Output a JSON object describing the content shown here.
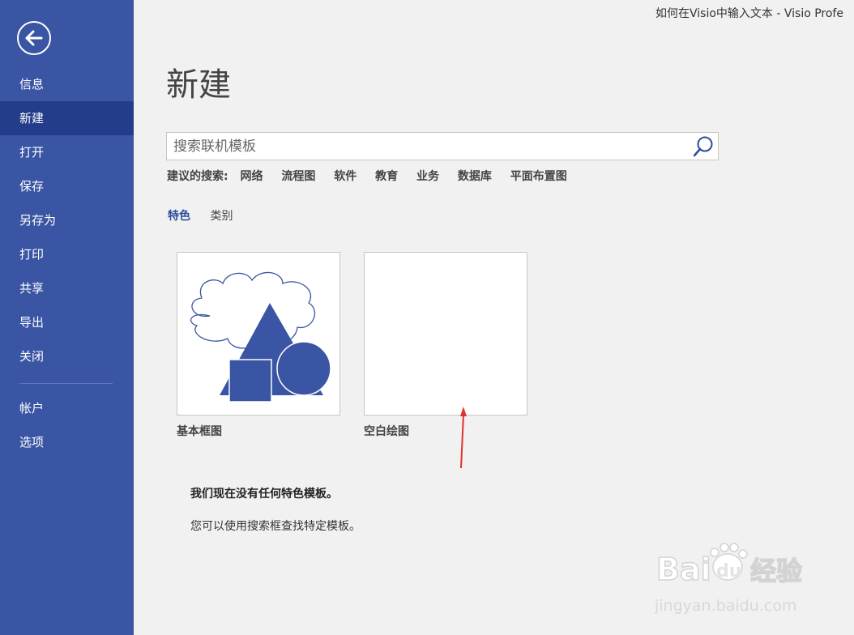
{
  "window": {
    "title": "如何在Visio中输入文本 - Visio Profe"
  },
  "sidebar": {
    "items": [
      {
        "label": "信息",
        "active": false
      },
      {
        "label": "新建",
        "active": true
      },
      {
        "label": "打开",
        "active": false
      },
      {
        "label": "保存",
        "active": false
      },
      {
        "label": "另存为",
        "active": false
      },
      {
        "label": "打印",
        "active": false
      },
      {
        "label": "共享",
        "active": false
      },
      {
        "label": "导出",
        "active": false
      },
      {
        "label": "关闭",
        "active": false
      }
    ],
    "bottom_items": [
      {
        "label": "帐户"
      },
      {
        "label": "选项"
      }
    ]
  },
  "main": {
    "title": "新建",
    "search": {
      "placeholder": "搜索联机模板",
      "value": ""
    },
    "suggested": {
      "label": "建议的搜索:",
      "links": [
        "网络",
        "流程图",
        "软件",
        "教育",
        "业务",
        "数据库",
        "平面布置图"
      ]
    },
    "tabs": [
      {
        "label": "特色",
        "active": true
      },
      {
        "label": "类别",
        "active": false
      }
    ],
    "templates": [
      {
        "label": "基本框图"
      },
      {
        "label": "空白绘图"
      }
    ],
    "message_bold": "我们现在没有任何特色模板。",
    "message": "您可以使用搜索框查找特定模板。"
  },
  "colors": {
    "sidebar_bg": "#3955a3",
    "sidebar_active": "#243d8a",
    "accent": "#2b4c9b",
    "shape_fill": "#3955a3"
  },
  "watermark": {
    "text1": "Bai",
    "text2": "经验",
    "url": "jingyan.baidu.com"
  }
}
